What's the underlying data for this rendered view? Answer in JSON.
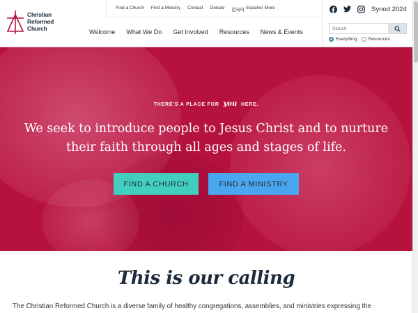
{
  "logo": {
    "lines": [
      "Christian",
      "Reformed",
      "Church"
    ]
  },
  "utility_nav": [
    "Find a Church",
    "Find a Ministry",
    "Contact",
    "Donate",
    "한국어",
    "Español",
    "More"
  ],
  "main_nav": [
    "Welcome",
    "What We Do",
    "Get Involved",
    "Resources",
    "News & Events"
  ],
  "social": {
    "icons": [
      "facebook-icon",
      "twitter-icon",
      "instagram-icon"
    ],
    "synod_label": "Synod 2024"
  },
  "search": {
    "placeholder": "Search",
    "options": [
      "Everything",
      "Resources"
    ],
    "selected": "Everything"
  },
  "hero": {
    "eyebrow_before": "THERE'S A PLACE FOR",
    "eyebrow_you": "you",
    "eyebrow_after": "HERE.",
    "headline_line1": "We seek to introduce people to Jesus Christ and to nurture",
    "headline_line2": "their faith through all ages and stages of life.",
    "primary_button": "FIND A CHURCH",
    "secondary_button": "FIND A MINISTRY"
  },
  "calling": {
    "title": "This is our calling",
    "intro": "The Christian Reformed Church is a diverse family of healthy congregations, assemblies, and ministries expressing the"
  },
  "colors": {
    "hero_bg": "#b5123f",
    "church_button": "#43cfc0",
    "ministry_button": "#4aa7ef",
    "text_dark": "#1d2a3a"
  }
}
